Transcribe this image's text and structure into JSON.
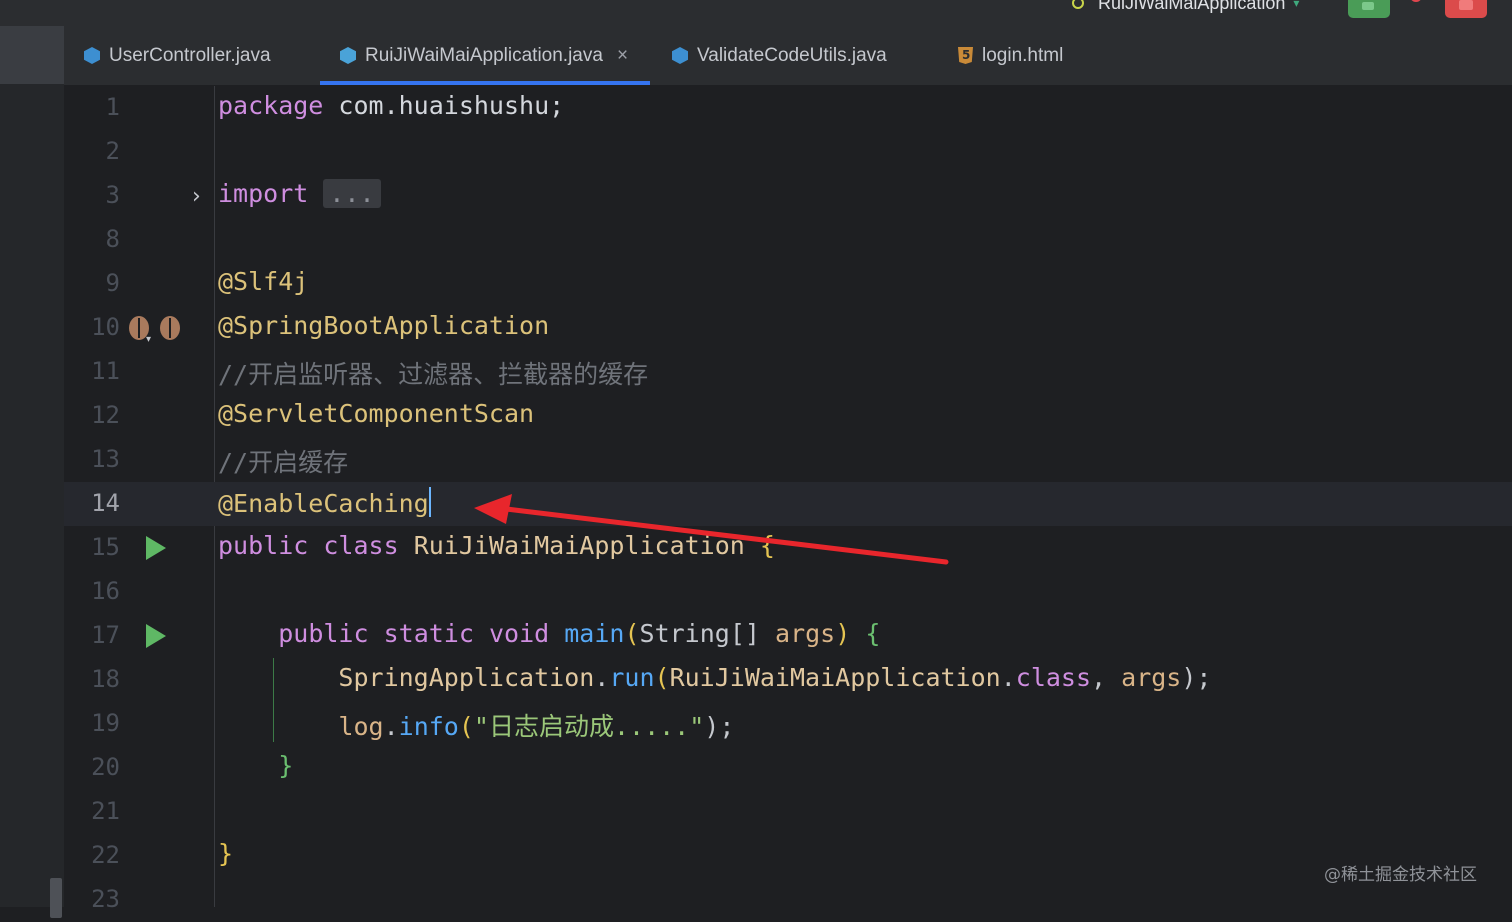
{
  "toolbar": {
    "run_config_label": "RuiJiWaiMaiApplication"
  },
  "tabs": [
    {
      "label": "UserController.java",
      "icon": "java-class-icon"
    },
    {
      "label": "RuiJiWaiMaiApplication.java",
      "icon": "spring-boot-class-icon",
      "active": true,
      "close": "×"
    },
    {
      "label": "ValidateCodeUtils.java",
      "icon": "java-class-icon"
    },
    {
      "label": "login.html",
      "icon": "html-file-icon"
    }
  ],
  "editor": {
    "current_line": "14",
    "lines": [
      {
        "n": "1",
        "package_kw": "package",
        "package_name": " com.huaishushu;"
      },
      {
        "n": "2"
      },
      {
        "n": "3",
        "import_kw": "import",
        "folded": "..."
      },
      {
        "n": "8"
      },
      {
        "n": "9",
        "text": "@Slf4j"
      },
      {
        "n": "10",
        "text": "@SpringBootApplication"
      },
      {
        "n": "11",
        "text": "//开启监听器、过滤器、拦截器的缓存"
      },
      {
        "n": "12",
        "text": "@ServletComponentScan"
      },
      {
        "n": "13",
        "text": "//开启缓存"
      },
      {
        "n": "14",
        "text": "@EnableCaching"
      },
      {
        "n": "15",
        "kw1": "public",
        "kw2": "class",
        "cls": "RuiJiWaiMaiApplication",
        "brace": "{"
      },
      {
        "n": "16"
      },
      {
        "n": "17",
        "kw1": "public",
        "kw2": "static",
        "kw3": "void",
        "fn": "main",
        "open": "(",
        "type": "String[]",
        "param": "args",
        "close": ")",
        "brace": "{"
      },
      {
        "n": "18",
        "cls": "SpringApplication",
        "dot": ".",
        "fn": "run",
        "open": "(",
        "arg1": "RuiJiWaiMaiApplication",
        "dot2": ".",
        "kw": "class",
        "comma": ", ",
        "arg2": "args",
        "close": ");"
      },
      {
        "n": "19",
        "obj": "log",
        "dot": ".",
        "fn": "info",
        "open": "(",
        "str": "\"日志启动成.....\"",
        "close": ");"
      },
      {
        "n": "20",
        "brace": "}"
      },
      {
        "n": "21"
      },
      {
        "n": "22",
        "brace": "}"
      },
      {
        "n": "23"
      }
    ]
  },
  "annotation": {
    "arrow_color": "#e8262c"
  },
  "watermark": "@稀土掘金技术社区"
}
